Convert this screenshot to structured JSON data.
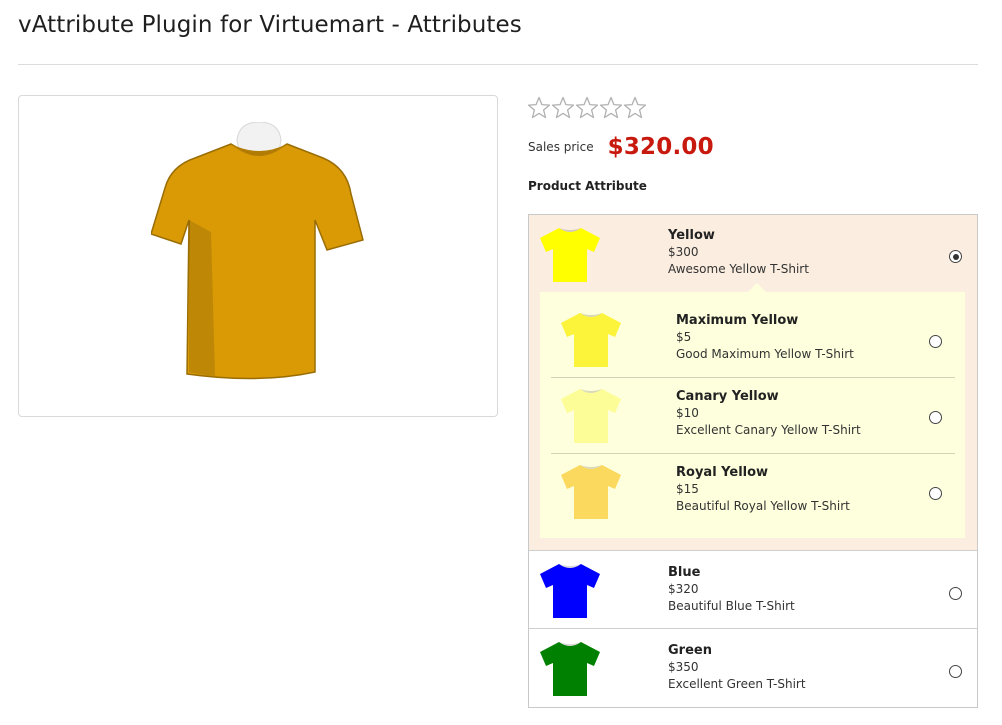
{
  "page": {
    "title": "vAttribute Plugin for Virtuemart - Attributes"
  },
  "product": {
    "image_color": "#d99a06",
    "rating": {
      "filled": 0,
      "max": 5,
      "icon": "star-outline-icon"
    },
    "price_label": "Sales price",
    "price": "$320.00",
    "price_color": "#c8190e",
    "attribute_section_label": "Product Attribute"
  },
  "attributes": [
    {
      "name": "Yellow",
      "price": "$300",
      "description": "Awesome Yellow T-Shirt",
      "color": "#ffff00",
      "selected": true,
      "children": [
        {
          "name": "Maximum Yellow",
          "price": "$5",
          "description": "Good Maximum Yellow T-Shirt",
          "color": "#fbf43a",
          "selected": false
        },
        {
          "name": "Canary Yellow",
          "price": "$10",
          "description": "Excellent Canary Yellow T-Shirt",
          "color": "#fdfd97",
          "selected": false
        },
        {
          "name": "Royal Yellow",
          "price": "$15",
          "description": "Beautiful Royal Yellow T-Shirt",
          "color": "#fbd95f",
          "selected": false
        }
      ]
    },
    {
      "name": "Blue",
      "price": "$320",
      "description": "Beautiful Blue T-Shirt",
      "color": "#0000ff",
      "selected": false
    },
    {
      "name": "Green",
      "price": "$350",
      "description": "Excellent Green T-Shirt",
      "color": "#008000",
      "selected": false
    }
  ]
}
